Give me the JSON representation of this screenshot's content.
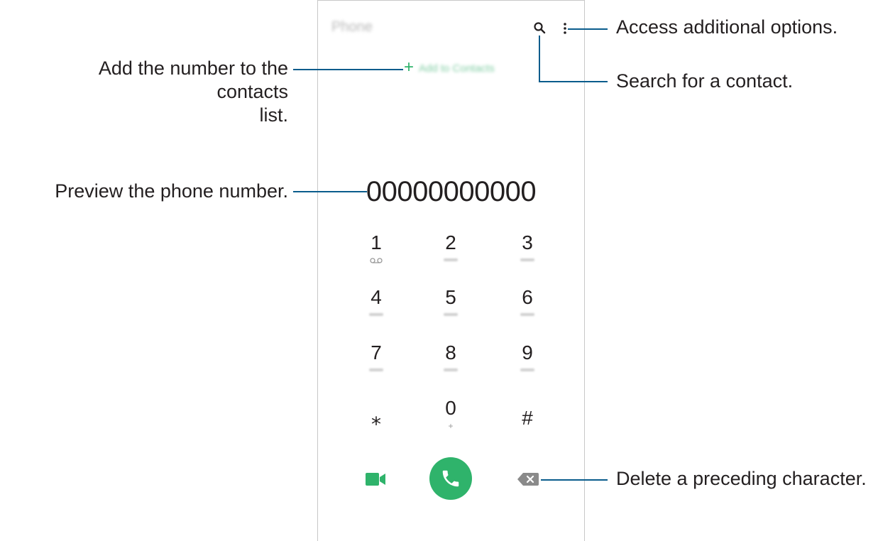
{
  "phone_screen": {
    "app_title": "Phone",
    "add_to_contacts_label": "Add to Contacts",
    "number_preview": "00000000000",
    "keypad": [
      {
        "digit": "1",
        "sub": "voicemail-icon"
      },
      {
        "digit": "2",
        "sub": "ABC"
      },
      {
        "digit": "3",
        "sub": "DEF"
      },
      {
        "digit": "4",
        "sub": "GHI"
      },
      {
        "digit": "5",
        "sub": "JKL"
      },
      {
        "digit": "6",
        "sub": "MNO"
      },
      {
        "digit": "7",
        "sub": "PQRS"
      },
      {
        "digit": "8",
        "sub": "TUV"
      },
      {
        "digit": "9",
        "sub": "WXYZ"
      },
      {
        "digit": "⁎",
        "sub": ""
      },
      {
        "digit": "0",
        "sub": "+"
      },
      {
        "digit": "#",
        "sub": ""
      }
    ],
    "icons": {
      "search": "search-icon",
      "more": "more-options-icon",
      "video_call": "video-call-icon",
      "call": "phone-call-icon",
      "backspace": "backspace-icon"
    },
    "colors": {
      "accent_green": "#2fb36b",
      "leader_line": "#0a5c8c"
    }
  },
  "annotations": {
    "more_options": "Access additional options.",
    "search": "Search for a contact.",
    "add_contacts_line1": "Add the number to the contacts",
    "add_contacts_line2": "list.",
    "preview": "Preview the phone number.",
    "delete": "Delete a preceding character."
  }
}
